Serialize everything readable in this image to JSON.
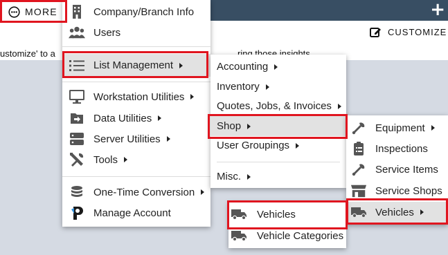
{
  "header": {
    "more_label": "MORE",
    "add_symbol": "+"
  },
  "content": {
    "customize_label": "CUSTOMIZE",
    "info_left": "ustomize' to a",
    "info_right": "ring those insights"
  },
  "main_menu": [
    {
      "label": "Company/Branch Info",
      "icon": "building-icon"
    },
    {
      "label": "Users",
      "icon": "users-icon"
    },
    {
      "label": "List Management",
      "icon": "list-icon",
      "submenu": true,
      "highlighted": true
    },
    {
      "label": "Workstation Utilities",
      "icon": "monitor-icon",
      "submenu": true
    },
    {
      "label": "Data Utilities",
      "icon": "data-import-icon",
      "submenu": true
    },
    {
      "label": "Server Utilities",
      "icon": "server-icon",
      "submenu": true
    },
    {
      "label": "Tools",
      "icon": "tools-icon",
      "submenu": true
    },
    {
      "label": "One-Time Conversion",
      "icon": "database-icon",
      "submenu": true
    },
    {
      "label": "Manage Account",
      "icon": "account-icon"
    }
  ],
  "list_menu": [
    {
      "label": "Accounting",
      "submenu": true
    },
    {
      "label": "Inventory",
      "submenu": true
    },
    {
      "label": "Quotes, Jobs, & Invoices",
      "submenu": true
    },
    {
      "label": "Shop",
      "submenu": true,
      "highlighted": true
    },
    {
      "label": "User Groupings",
      "submenu": true
    },
    {
      "label": "Misc.",
      "submenu": true
    }
  ],
  "shop_menu": [
    {
      "label": "Equipment",
      "icon": "wrench-icon",
      "submenu": true
    },
    {
      "label": "Inspections",
      "icon": "clipboard-icon"
    },
    {
      "label": "Service Items",
      "icon": "wrench-icon"
    },
    {
      "label": "Service Shops",
      "icon": "storefront-icon"
    },
    {
      "label": "Vehicles",
      "icon": "truck-icon",
      "submenu": true,
      "highlighted": true
    }
  ],
  "vehicles_menu": [
    {
      "label": "Vehicles",
      "icon": "truck-icon"
    },
    {
      "label": "Vehicle Categories",
      "icon": "truck-icon"
    }
  ],
  "colors": {
    "topbar": "#384e63",
    "highlight": "#e2e2e2",
    "annotation": "#e0151f",
    "background": "#d5dae3"
  }
}
